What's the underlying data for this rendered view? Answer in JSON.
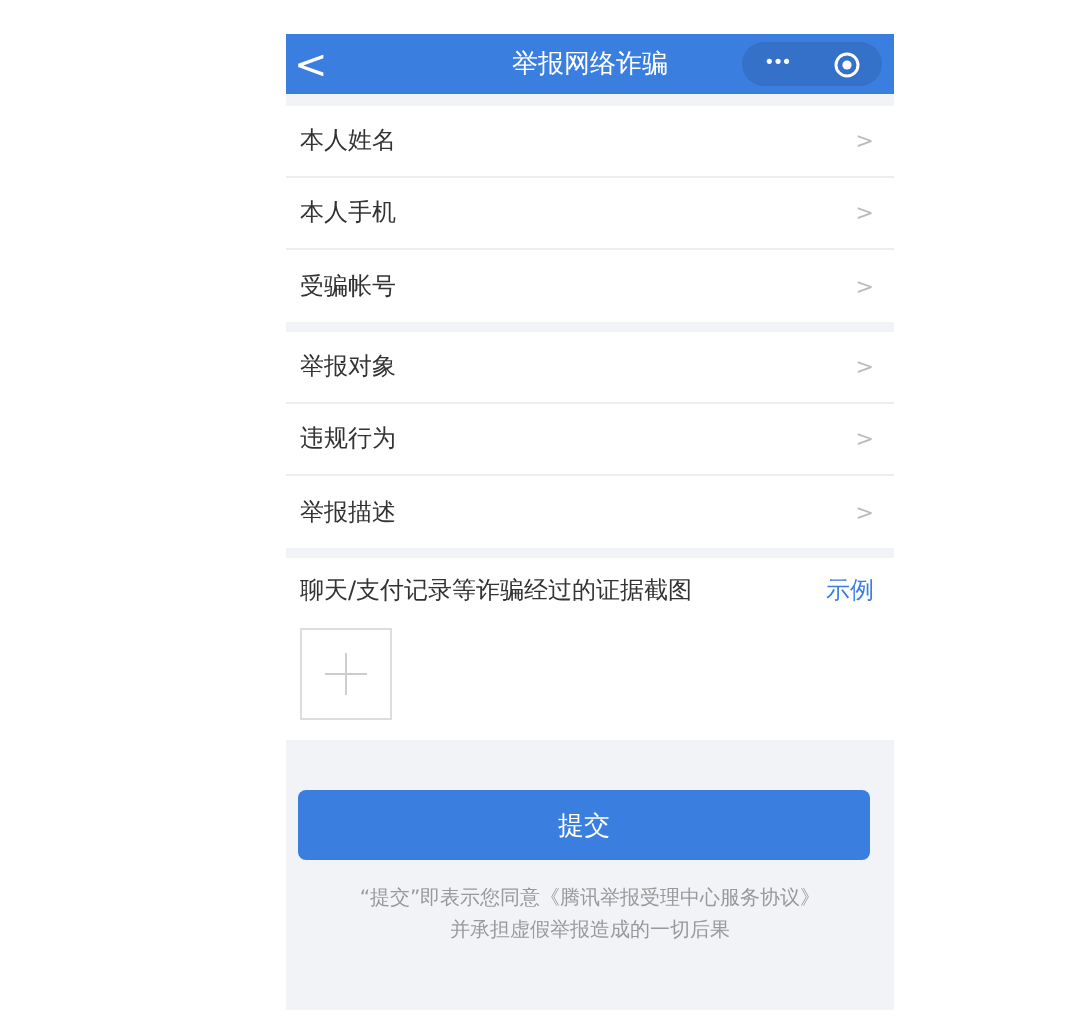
{
  "header": {
    "back": "<",
    "title": "举报网络诈骗",
    "more": "•••"
  },
  "groups": [
    {
      "rows": [
        {
          "label": "本人姓名",
          "chevron": ">"
        },
        {
          "label": "本人手机",
          "chevron": ">"
        },
        {
          "label": "受骗帐号",
          "chevron": ">"
        }
      ]
    },
    {
      "rows": [
        {
          "label": "举报对象",
          "chevron": ">"
        },
        {
          "label": "违规行为",
          "chevron": ">"
        },
        {
          "label": "举报描述",
          "chevron": ">"
        }
      ]
    }
  ],
  "evidence": {
    "label": "聊天/支付记录等诈骗经过的证据截图",
    "example_link": "示例"
  },
  "submit": "提交",
  "notice": [
    "“提交”即表示您同意《腾讯举报受理中心服务协议》",
    "并承担虚假举报造成的一切后果"
  ]
}
